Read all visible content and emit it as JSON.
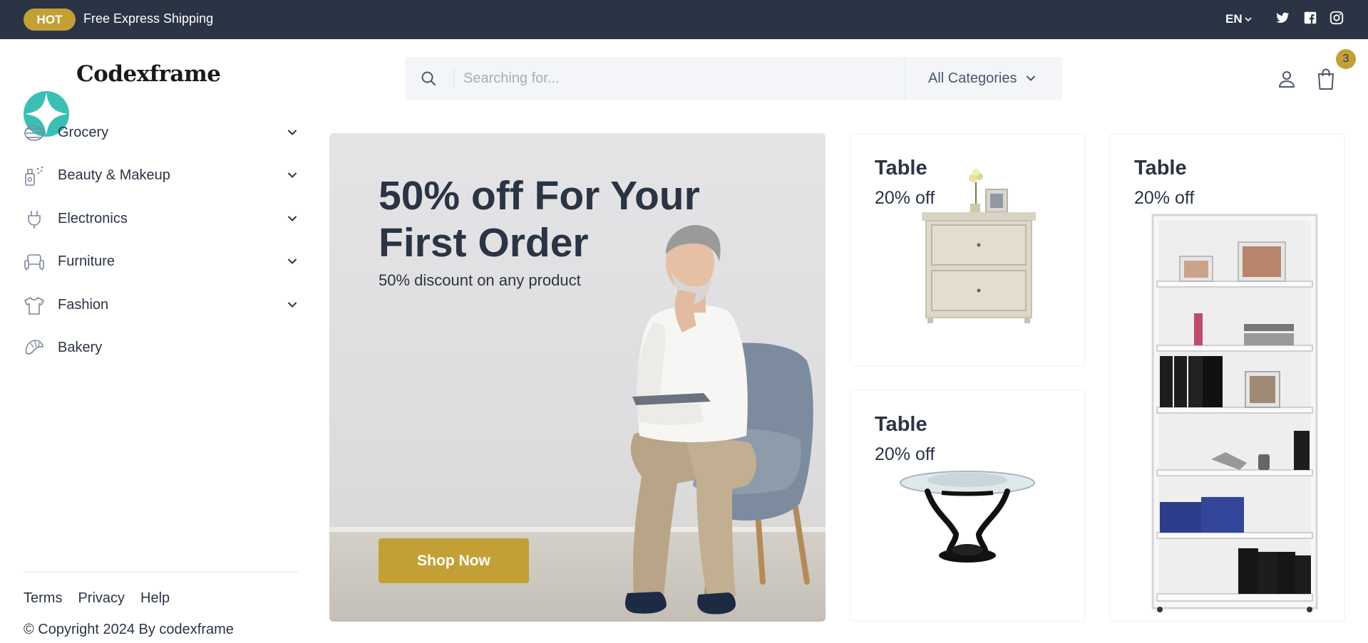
{
  "topbar": {
    "badge": "HOT",
    "promo": "Free Express Shipping",
    "language": "EN",
    "social_icons": [
      "twitter-icon",
      "facebook-icon",
      "instagram-icon"
    ]
  },
  "header": {
    "logo_text": "Codexframe",
    "search": {
      "placeholder": "Searching for..."
    },
    "category_select": "All Categories",
    "cart_count": "3"
  },
  "sidebar": {
    "items": [
      {
        "label": "Grocery",
        "icon": "grocery-icon",
        "has_submenu": true
      },
      {
        "label": "Beauty & Makeup",
        "icon": "beauty-icon",
        "has_submenu": true
      },
      {
        "label": "Electronics",
        "icon": "plug-icon",
        "has_submenu": true
      },
      {
        "label": "Furniture",
        "icon": "sofa-icon",
        "has_submenu": true
      },
      {
        "label": "Fashion",
        "icon": "tshirt-icon",
        "has_submenu": true
      },
      {
        "label": "Bakery",
        "icon": "croissant-icon",
        "has_submenu": false
      }
    ],
    "footer_links": [
      "Terms",
      "Privacy",
      "Help"
    ],
    "copyright": "© Copyright 2024 By codexframe"
  },
  "hero": {
    "title": "50% off For Your First Order",
    "subtitle": "50% discount on any product",
    "button": "Shop Now"
  },
  "cards": [
    {
      "title": "Table",
      "subtitle": "20% off",
      "image": "nightstand-image"
    },
    {
      "title": "Table",
      "subtitle": "20% off",
      "image": "glass-table-image"
    },
    {
      "title": "Table",
      "subtitle": "20% off",
      "image": "bookshelf-image"
    }
  ],
  "colors": {
    "topbar": "#2b3445",
    "accent": "#c3a036",
    "text": "#2b3445",
    "logo": "#3bbfb4"
  }
}
